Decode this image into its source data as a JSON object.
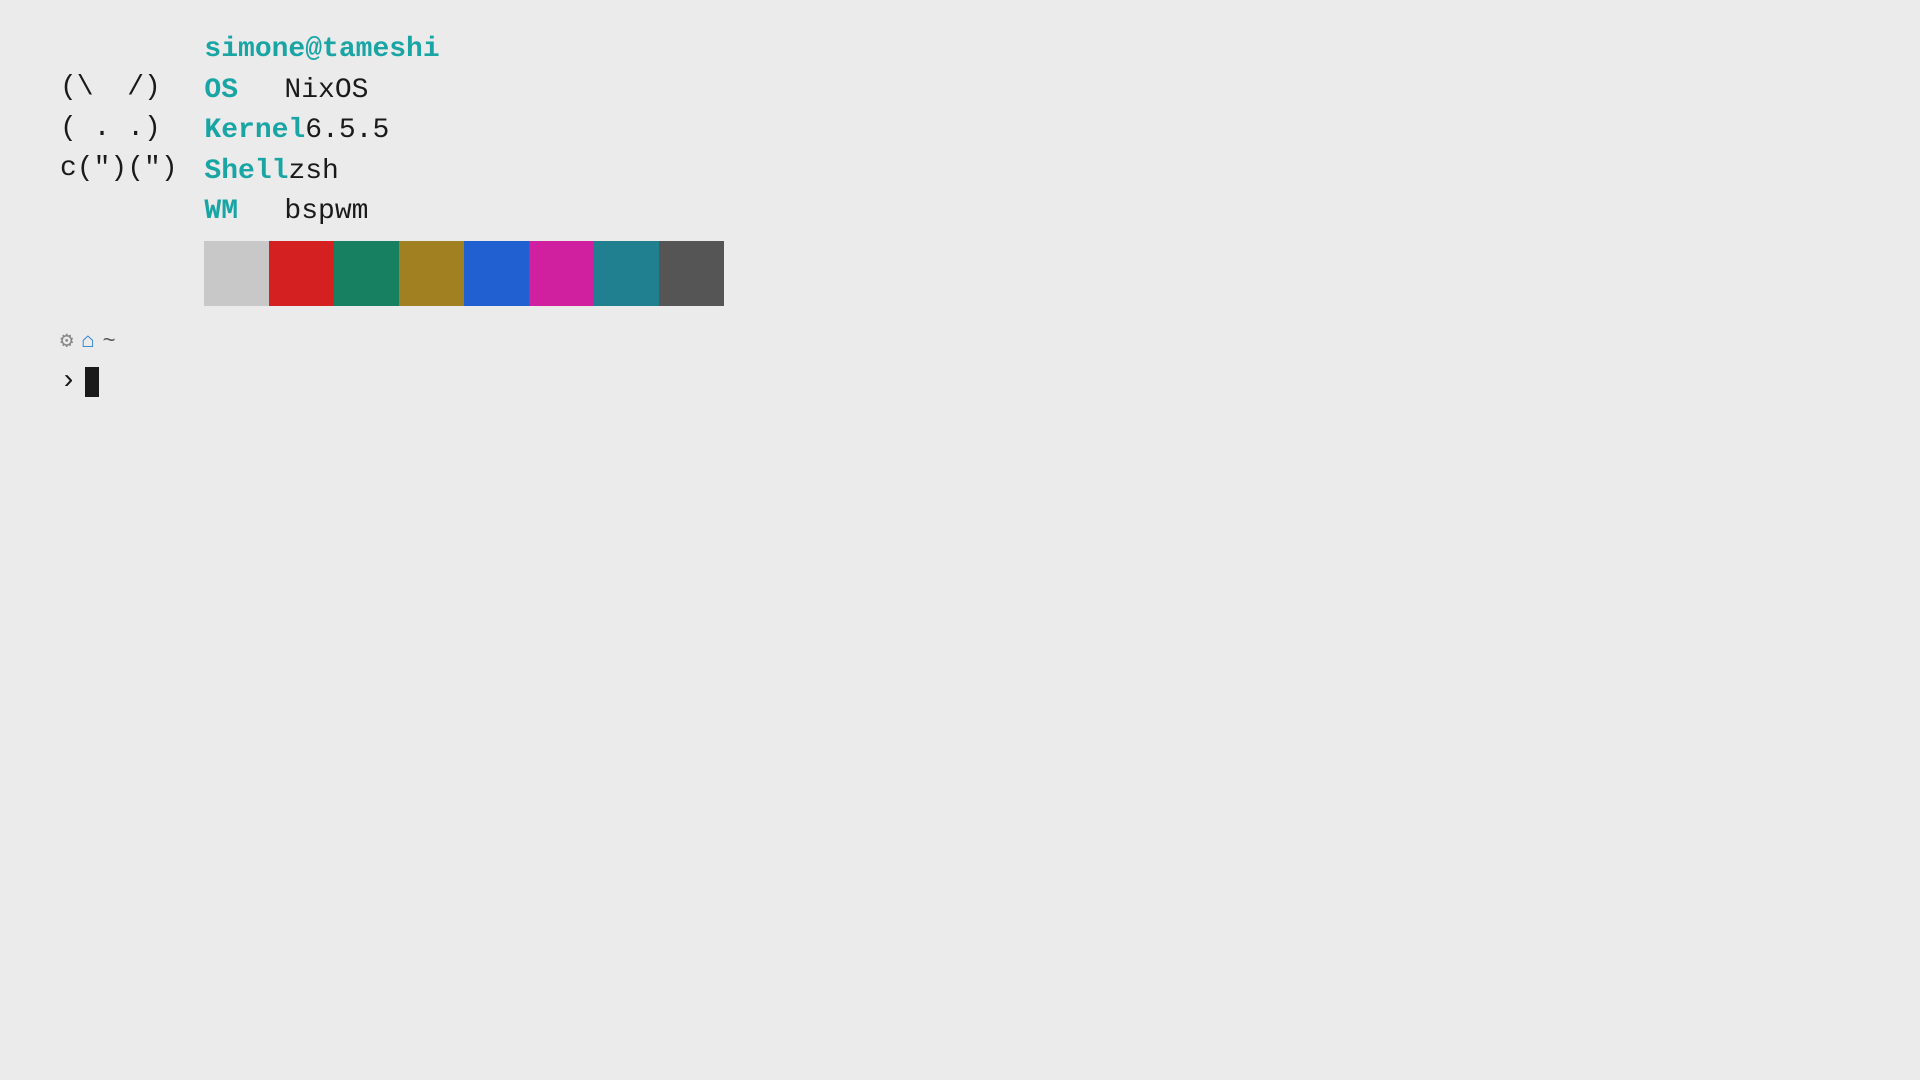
{
  "terminal": {
    "background": "#ebebeb"
  },
  "neofetch": {
    "ascii_art": "(\\  /)\n( . .)\nc(\")(\") ",
    "username": "simone@tameshi",
    "os_label": "OS",
    "os_value": "NixOS",
    "kernel_label": "Kernel",
    "kernel_value": "6.5.5",
    "shell_label": "Shell",
    "shell_value": "zsh",
    "wm_label": "WM",
    "wm_value": "bspwm"
  },
  "color_swatches": [
    {
      "color": "#c8c8c8",
      "name": "light-gray"
    },
    {
      "color": "#d42020",
      "name": "red"
    },
    {
      "color": "#178060",
      "name": "green"
    },
    {
      "color": "#a08020",
      "name": "yellow-olive"
    },
    {
      "color": "#2060d0",
      "name": "blue"
    },
    {
      "color": "#d020a0",
      "name": "magenta"
    },
    {
      "color": "#208090",
      "name": "teal"
    },
    {
      "color": "#555555",
      "name": "dark-gray"
    }
  ],
  "prompt": {
    "gear_symbol": "⚙",
    "home_symbol": "⌂",
    "tilde_symbol": "~",
    "chevron": "›",
    "path_label": "~"
  }
}
